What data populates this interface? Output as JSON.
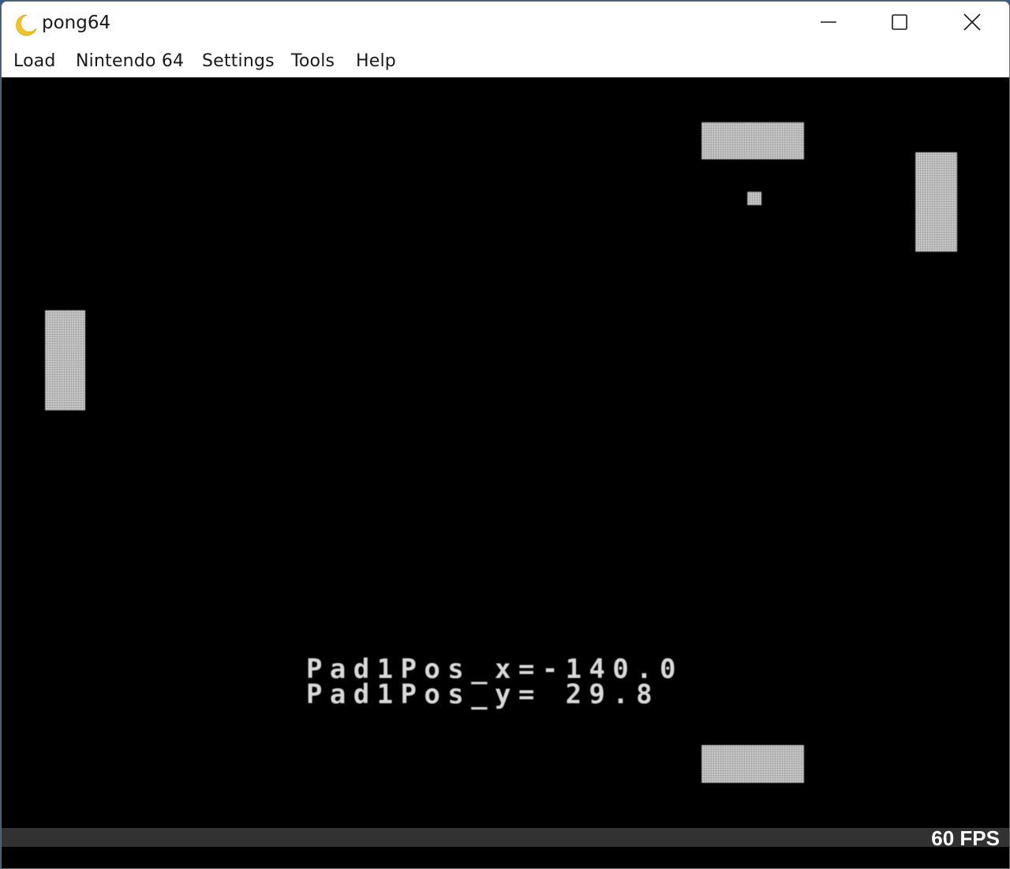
{
  "window": {
    "title": "pong64",
    "app_icon": "crescent-moon-icon",
    "controls": {
      "minimize_icon": "minimize-icon",
      "maximize_icon": "maximize-icon",
      "close_icon": "close-icon"
    }
  },
  "menubar": {
    "items": [
      "Load",
      "Nintendo 64",
      "Settings",
      "Tools",
      "Help"
    ]
  },
  "game": {
    "background_color": "#000000",
    "block_color": "#d8d8d8",
    "debug": {
      "line1": "Pad1Pos_x=-140.0",
      "line2": "Pad1Pos_y= 29.8"
    }
  },
  "status": {
    "fps": "60 FPS"
  },
  "colors": {
    "moon_icon": "#f5c518",
    "status_bar": "#323232",
    "text": "#1a1a1a"
  }
}
